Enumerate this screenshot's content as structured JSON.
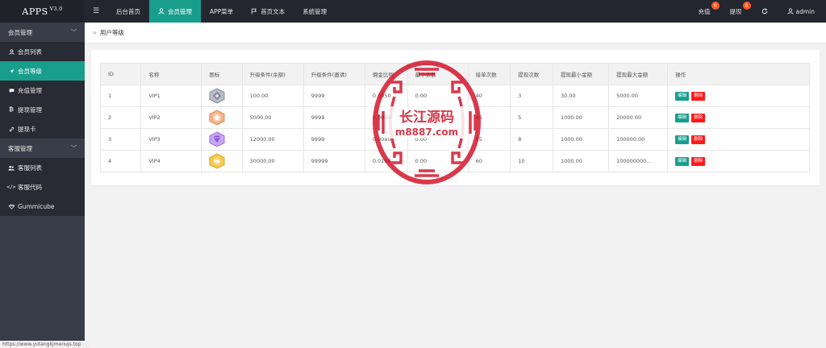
{
  "app": {
    "name": "APPS",
    "version": "V3.0"
  },
  "topnav": [
    {
      "label": "后台首页",
      "icon": "",
      "active": false
    },
    {
      "label": "会员管理",
      "icon": "user-icon",
      "active": true
    },
    {
      "label": "APP菜单",
      "icon": "",
      "active": false
    },
    {
      "label": "首页文本",
      "icon": "flag-icon",
      "active": false
    },
    {
      "label": "系统管理",
      "icon": "",
      "active": false
    }
  ],
  "topright": {
    "recharge_label": "充值",
    "recharge_badge": "0",
    "withdraw_label": "提现",
    "withdraw_badge": "0",
    "user_label": "admin"
  },
  "sidebar": {
    "group1": "会员管理",
    "group1_items": [
      {
        "label": "会员列表",
        "icon": "user-icon"
      },
      {
        "label": "会员等级",
        "icon": "rocket-icon",
        "active": true
      },
      {
        "label": "充值管理",
        "icon": "chat-icon"
      },
      {
        "label": "提现管理",
        "icon": "bitcoin-icon"
      },
      {
        "label": "提现卡",
        "icon": "link-icon"
      }
    ],
    "group2": "客服管理",
    "group2_items": [
      {
        "label": "客服列表",
        "icon": "users-icon"
      },
      {
        "label": "客服代码",
        "icon": "code-icon"
      },
      {
        "label": "Gummicube",
        "icon": "gem-icon"
      }
    ]
  },
  "status_link": "https://www.yutangkjmenujs.top",
  "breadcrumb": {
    "current": "用户等级"
  },
  "table": {
    "headers": [
      "ID",
      "名称",
      "图标",
      "升级条件(余额)",
      "升级条件(邀请)",
      "佣金比例",
      "最小余额",
      "接单次数",
      "提现次数",
      "提现最小金额",
      "提现最大金额",
      "操作"
    ],
    "rows": [
      {
        "id": "1",
        "name": "VIP1",
        "icon": "silver",
        "balance": "100.00",
        "invite": "9999",
        "rate": "0.0050",
        "min": "0.00",
        "orders": "40",
        "withdraw_times": "3",
        "wmin": "30.00",
        "wmax": "5000.00"
      },
      {
        "id": "2",
        "name": "VIP2",
        "icon": "bronze",
        "balance": "5000.00",
        "invite": "9999",
        "rate": "0.0060",
        "min": "0.00",
        "orders": "45",
        "withdraw_times": "5",
        "wmin": "1000.00",
        "wmax": "20000.00"
      },
      {
        "id": "3",
        "name": "VIP3",
        "icon": "purple",
        "balance": "12000.00",
        "invite": "9999",
        "rate": "0.0080",
        "min": "0.00",
        "orders": "55",
        "withdraw_times": "8",
        "wmin": "1000.00",
        "wmax": "100000.00"
      },
      {
        "id": "4",
        "name": "VIP4",
        "icon": "gold",
        "balance": "30000.00",
        "invite": "99999",
        "rate": "0.0100",
        "min": "0.00",
        "orders": "60",
        "withdraw_times": "10",
        "wmin": "1000.00",
        "wmax": "100000000..."
      }
    ],
    "edit_label": "编辑",
    "delete_label": "删除"
  },
  "watermark": {
    "line1": "长江源码",
    "line2": "m8887.com"
  },
  "colors": {
    "accent": "#199e8d",
    "topbar": "#23262e",
    "sidebar": "#393d49",
    "danger": "#ff1a1a",
    "watermark": "#d0021b"
  }
}
